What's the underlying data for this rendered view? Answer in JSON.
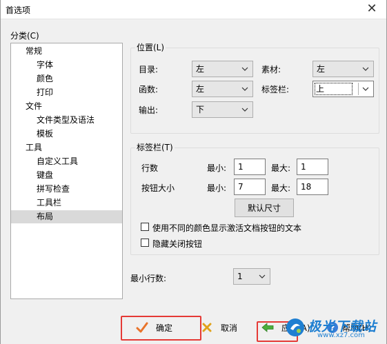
{
  "window": {
    "title": "首选项"
  },
  "category_label": "分类(C)",
  "tree": [
    {
      "label": "常规",
      "level": 0
    },
    {
      "label": "字体",
      "level": 1
    },
    {
      "label": "颜色",
      "level": 1
    },
    {
      "label": "打印",
      "level": 1
    },
    {
      "label": "文件",
      "level": 0
    },
    {
      "label": "文件类型及语法",
      "level": 1
    },
    {
      "label": "模板",
      "level": 1
    },
    {
      "label": "工具",
      "level": 0
    },
    {
      "label": "自定义工具",
      "level": 1
    },
    {
      "label": "键盘",
      "level": 1
    },
    {
      "label": "拼写检查",
      "level": 1
    },
    {
      "label": "工具栏",
      "level": 1
    },
    {
      "label": "布局",
      "level": 1,
      "selected": true
    }
  ],
  "position_group": {
    "title": "位置(L)",
    "directory_label": "目录:",
    "directory_value": "左",
    "material_label": "素材:",
    "material_value": "左",
    "function_label": "函数:",
    "function_value": "左",
    "tabbar_label": "标签栏:",
    "tabbar_value": "上",
    "output_label": "输出:",
    "output_value": "下"
  },
  "tabbar_group": {
    "title": "标签栏(T)",
    "rows_label": "行数",
    "rows_min_label": "最小:",
    "rows_min_value": "1",
    "rows_max_label": "最大:",
    "rows_max_value": "1",
    "btnsize_label": "按钮大小",
    "btn_min_label": "最小:",
    "btn_min_value": "7",
    "btn_max_label": "最大:",
    "btn_max_value": "18",
    "default_size_button": "默认尺寸",
    "checkbox1_label": "使用不同的颜色显示激活文档按钮的文本",
    "checkbox1_checked": false,
    "checkbox2_label": "隐藏关闭按钮",
    "checkbox2_checked": false
  },
  "min_rows": {
    "label": "最小行数:",
    "value": "1"
  },
  "footer": {
    "ok": "确定",
    "cancel": "取消",
    "apply": "应用(A)",
    "help": "帮助(H)"
  },
  "watermark": {
    "text": "极光下载站",
    "url": "www.xz7.com"
  },
  "colors": {
    "highlight": "#e53935",
    "watermark": "#1f7fd1"
  }
}
